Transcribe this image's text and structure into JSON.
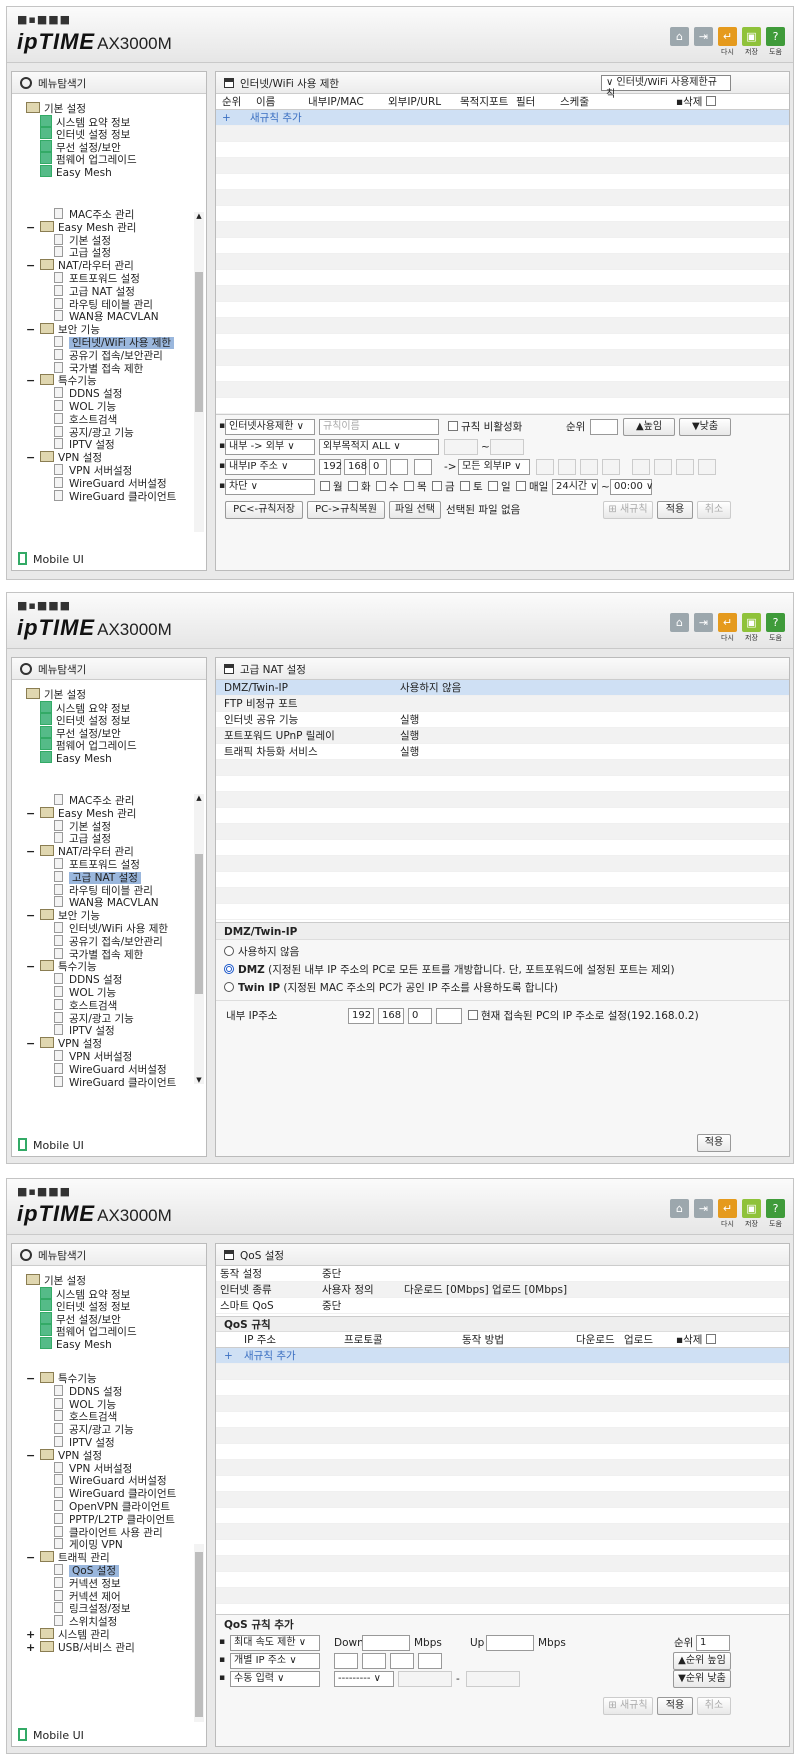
{
  "header": {
    "dots": "■▪■■■",
    "logo": "ipTIME",
    "model": "AX3000M",
    "buttons": {
      "home": "",
      "logout": "",
      "back": "다시",
      "save": "저장",
      "help": "도움"
    }
  },
  "sidebar": {
    "title": "메뉴탐색기",
    "mobile": "Mobile UI",
    "top": [
      "기본 설정",
      "시스템 요약 정보",
      "인터넷 설정 정보",
      "무선 설정/보안",
      "펌웨어 업그레이드",
      "Easy Mesh"
    ],
    "list1": [
      "MAC주소 관리",
      "Easy Mesh 관리",
      "기본 설정",
      "고급 설정",
      "NAT/라우터 관리",
      "포트포워드 설정",
      "고급 NAT 설정",
      "라우팅 테이블 관리",
      "WAN용 MACVLAN",
      "보안 기능",
      "인터넷/WiFi 사용 제한",
      "공유기 접속/보안관리",
      "국가별 접속 제한",
      "특수기능",
      "DDNS 설정",
      "WOL 기능",
      "호스트검색",
      "공지/광고 기능",
      "IPTV 설정",
      "VPN 설정",
      "VPN 서버설정",
      "WireGuard 서버설정",
      "WireGuard 클라이언트"
    ],
    "list3": [
      "특수기능",
      "DDNS 설정",
      "WOL 기능",
      "호스트검색",
      "공지/광고 기능",
      "IPTV 설정",
      "VPN 설정",
      "VPN 서버설정",
      "WireGuard 서버설정",
      "WireGuard 클라이언트",
      "OpenVPN 클라이언트",
      "PPTP/L2TP 클라이언트",
      "클라이언트 사용 관리",
      "게이밍 VPN",
      "트래픽 관리",
      "QoS 설정",
      "커넥션 정보",
      "커넥션 제어",
      "링크설정/정보",
      "스위치설정",
      "시스템 관리",
      "USB/서비스 관리"
    ]
  },
  "p1": {
    "title": "인터넷/WiFi 사용 제한",
    "dropdown": "인터넷/WiFi 사용제한규칙",
    "cols": [
      "순위",
      "이름",
      "내부IP/MAC",
      "외부IP/URL",
      "목적지포트",
      "필터",
      "스케줄",
      "삭제"
    ],
    "add": "새규칙 추가",
    "form": {
      "type": "인터넷사용제한",
      "name_ph": "규칙이름",
      "private": "규칙 비활성화",
      "order": "순위",
      "up": "▲높임",
      "down": "▼낮춤",
      "dir": "내부 -> 외부",
      "dest": "외부목적지 ALL",
      "tilde": "~",
      "src": "내부IP 주소",
      "ip": [
        "192",
        "168",
        "0",
        ""
      ],
      "arrow": "->",
      "ext": "모든 외부IP",
      "action": "차단",
      "days": [
        "월",
        "화",
        "수",
        "목",
        "금",
        "토",
        "일",
        "매일"
      ],
      "hours": "24시간",
      "time": "00:00",
      "save": "PC<-규칙저장",
      "restore": "PC->규칙복원",
      "file": "파일 선택",
      "nofile": "선택된 파일 없음",
      "newrule": "새규칙",
      "apply": "적용",
      "cancel": "취소"
    }
  },
  "p2": {
    "title": "고급 NAT 설정",
    "rows": [
      [
        "DMZ/Twin-IP",
        "사용하지 않음"
      ],
      [
        "FTP 비정규 포트",
        ""
      ],
      [
        "인터넷 공유 기능",
        "실행"
      ],
      [
        "포트포워드 UPnP 릴레이",
        "실행"
      ],
      [
        "트래픽 차등화 서비스",
        "실행"
      ]
    ],
    "section": "DMZ/Twin-IP",
    "opt1": "사용하지 않음",
    "opt2": "DMZ",
    "opt2d": "(지정된 내부 IP 주소의 PC로 모든 포트를 개방합니다. 단, 포트포워드에 설정된 포트는 제외)",
    "opt3": "Twin IP",
    "opt3d": "(지정된 MAC 주소의 PC가 공인 IP 주소를 사용하도록 합니다)",
    "iplabel": "내부 IP주소",
    "ip": [
      "192",
      "168",
      "0",
      ""
    ],
    "cur": "현재 접속된 PC의 IP 주소로 설정(192.168.0.2)",
    "apply": "적용"
  },
  "p3": {
    "title": "QoS 설정",
    "rows": [
      [
        "동작 설정",
        "중단",
        ""
      ],
      [
        "인터넷 종류",
        "사용자 정의",
        "다운로드 [0Mbps] 업로드 [0Mbps]"
      ],
      [
        "스마트 QoS",
        "중단",
        ""
      ]
    ],
    "rules": "QoS 규칙",
    "cols": [
      "IP 주소",
      "프로토콜",
      "동작 방법",
      "다운로드",
      "업로드",
      "삭제"
    ],
    "add": "새규칙 추가",
    "addsec": "QoS 규칙 추가",
    "mode": "최대 속도 제한",
    "down": "Down",
    "mbps": "Mbps",
    "up": "Up",
    "order": "순위",
    "orderval": "1",
    "ipmode": "개별 IP 주소",
    "manual": "수동 입력",
    "dash": "---------",
    "hyph": "-",
    "upbtn": "▲순위 높임",
    "downbtn": "▼순위 낮춤",
    "newrule": "새규칙",
    "apply": "적용",
    "cancel": "취소"
  }
}
